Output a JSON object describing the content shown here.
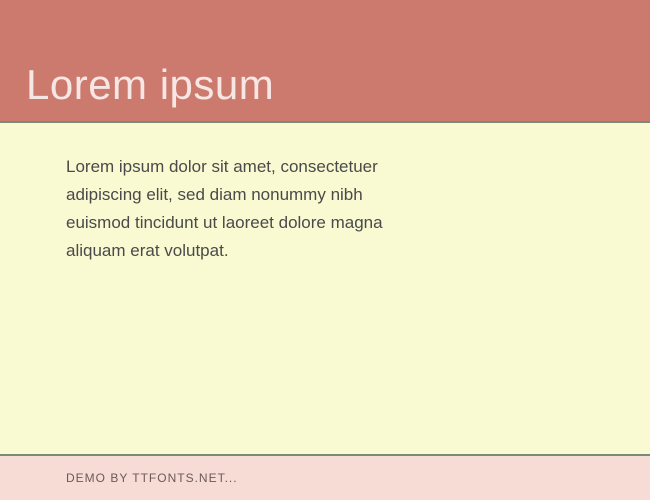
{
  "header": {
    "title": "Lorem ipsum"
  },
  "body": {
    "paragraph": "Lorem ipsum dolor sit amet, consectetuer adipiscing elit, sed diam nonummy nibh euismod tincidunt ut laoreet dolore magna aliquam erat volutpat."
  },
  "footer": {
    "text": "DEMO BY TTFONTS.NET..."
  }
}
